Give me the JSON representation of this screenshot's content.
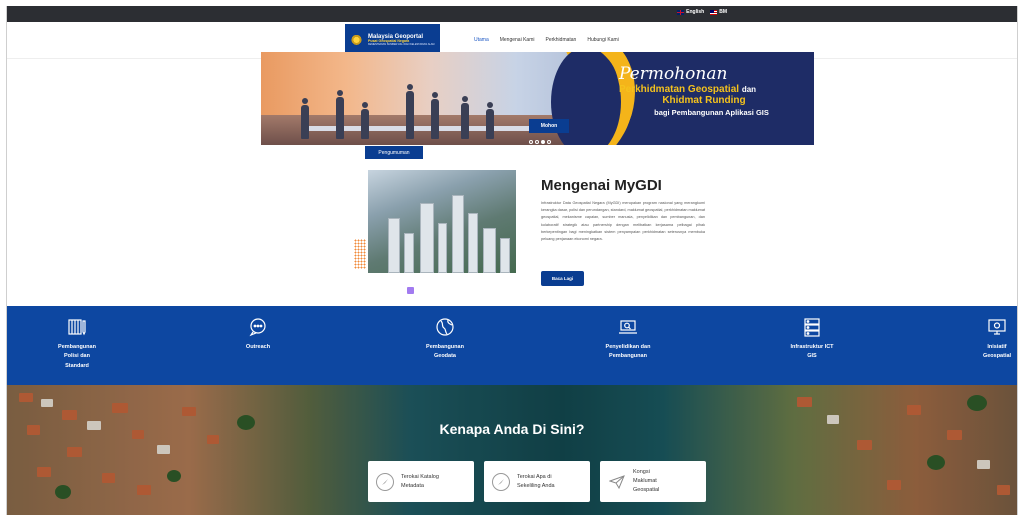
{
  "topbar": {
    "lang_en": "English",
    "lang_my": "BM"
  },
  "logo": {
    "line1": "Malaysia Geoportal",
    "line2": "Pusat Geospatial Negara",
    "line3": "KEMENTERIAN SUMBER ASLI DAN KELESTARIAN ALAM"
  },
  "menu": [
    "Utama",
    "Mengenai Kami",
    "Perkhidmatan",
    "Hubungi Kami"
  ],
  "hero": {
    "line1": "Permohonan",
    "line2": "Perkhidmatan Geospatial",
    "line2_suffix": "dan",
    "line3": "Khidmat Runding",
    "line4": "bagi Pembangunan Aplikasi GIS",
    "button": "Mohon",
    "slide_count": 4,
    "active_slide": 3
  },
  "pengumuman": "Pengumuman",
  "about": {
    "title": "Mengenai MyGDI",
    "body": "Infrastruktur Data Geospatial Negara (MyGDI) merupakan program nasional yang merangkumi kerangka dasar, polisi dan perundangan, standard, maklumat geospatial, perkhidmatan maklumat geospatial, mekanisme capaian, sumber manusia, penyelidikan dan pembangunan, dan kolaboratif strategik atau partnership dengan melibatkan kerjasama pelbagai pihak berkepentingan bagi meningkatkan sistem penyampaian perkhidmatan seterusnya membuka peluang penjanaan ekonomi negara.",
    "button": "Baca Lagi"
  },
  "services": [
    {
      "label": "Pembangunan\nPolisi dan\nStandard",
      "icon": "policy-icon"
    },
    {
      "label": "Outreach",
      "icon": "chat-bubble-icon"
    },
    {
      "label": "Pembangunan\nGeodata",
      "icon": "globe-icon"
    },
    {
      "label": "Penyelidikan dan\nPembangunan",
      "icon": "laptop-search-icon"
    },
    {
      "label": "Infrastruktur ICT\nGIS",
      "icon": "server-icon"
    },
    {
      "label": "Inisiatif\nGeospatial",
      "icon": "monitor-icon"
    }
  ],
  "why": {
    "title": "Kenapa Anda Di Sini?",
    "cards": [
      {
        "label": "Terokai Katalog\nMetadata",
        "icon": "compass-icon"
      },
      {
        "label": "Terokai Apa di\nSekeliling Anda",
        "icon": "compass-icon"
      },
      {
        "label": "Kongsi\nMaklumat\nGeospatial",
        "icon": "paper-plane-icon"
      }
    ]
  },
  "colors": {
    "primary_blue": "#0d47a1",
    "accent_yellow": "#f4b41a",
    "topbar": "#2c2e33"
  }
}
